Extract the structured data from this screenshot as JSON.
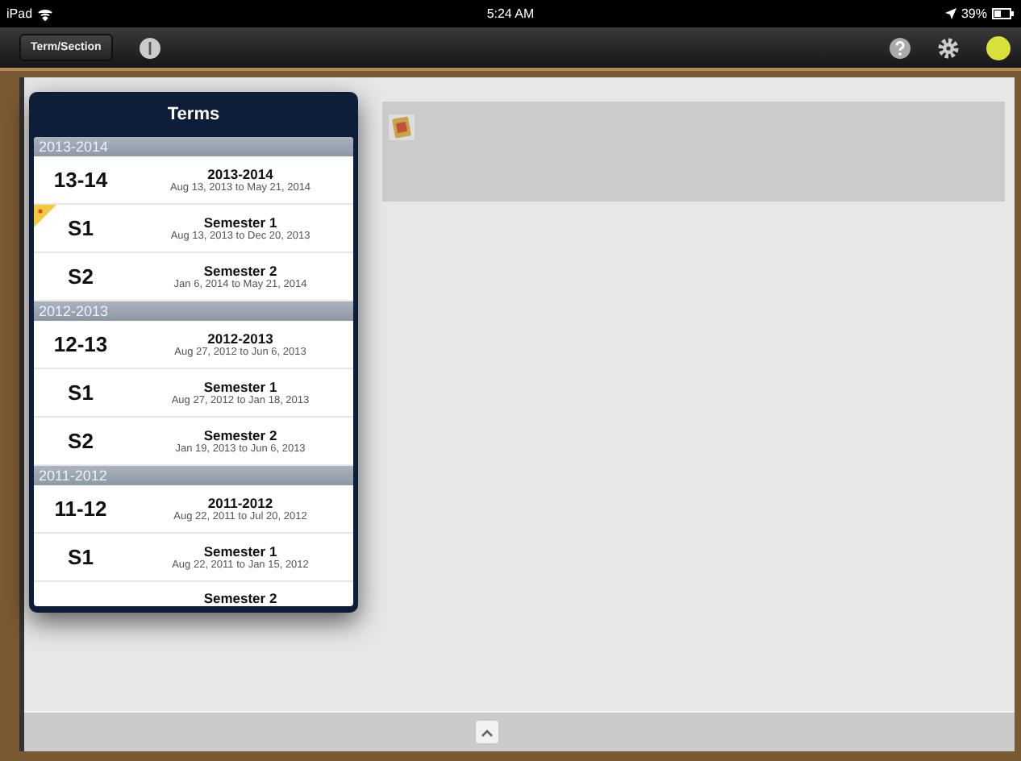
{
  "status_bar": {
    "device": "iPad",
    "time": "5:24 AM",
    "battery": "39%"
  },
  "toolbar": {
    "term_button": "Term/Section"
  },
  "popover": {
    "title": "Terms",
    "sections": [
      {
        "header": "2013-2014",
        "rows": [
          {
            "abbr": "13-14",
            "title": "2013-2014",
            "dates": "Aug 13, 2013 to May 21, 2014",
            "current": false
          },
          {
            "abbr": "S1",
            "title": "Semester 1",
            "dates": "Aug 13, 2013 to Dec 20, 2013",
            "current": true
          },
          {
            "abbr": "S2",
            "title": "Semester 2",
            "dates": "Jan 6, 2014 to May 21, 2014",
            "current": false
          }
        ]
      },
      {
        "header": "2012-2013",
        "rows": [
          {
            "abbr": "12-13",
            "title": "2012-2013",
            "dates": "Aug 27, 2012 to Jun 6, 2013",
            "current": false
          },
          {
            "abbr": "S1",
            "title": "Semester 1",
            "dates": "Aug 27, 2012 to Jan 18, 2013",
            "current": false
          },
          {
            "abbr": "S2",
            "title": "Semester 2",
            "dates": "Jan 19, 2013 to Jun 6, 2013",
            "current": false
          }
        ]
      },
      {
        "header": "2011-2012",
        "rows": [
          {
            "abbr": "11-12",
            "title": "2011-2012",
            "dates": "Aug 22, 2011 to Jul 20, 2012",
            "current": false
          },
          {
            "abbr": "S1",
            "title": "Semester 1",
            "dates": "Aug 22, 2011 to Jan 15, 2012",
            "current": false
          },
          {
            "title": "Semester 2",
            "current": false
          }
        ]
      }
    ]
  }
}
